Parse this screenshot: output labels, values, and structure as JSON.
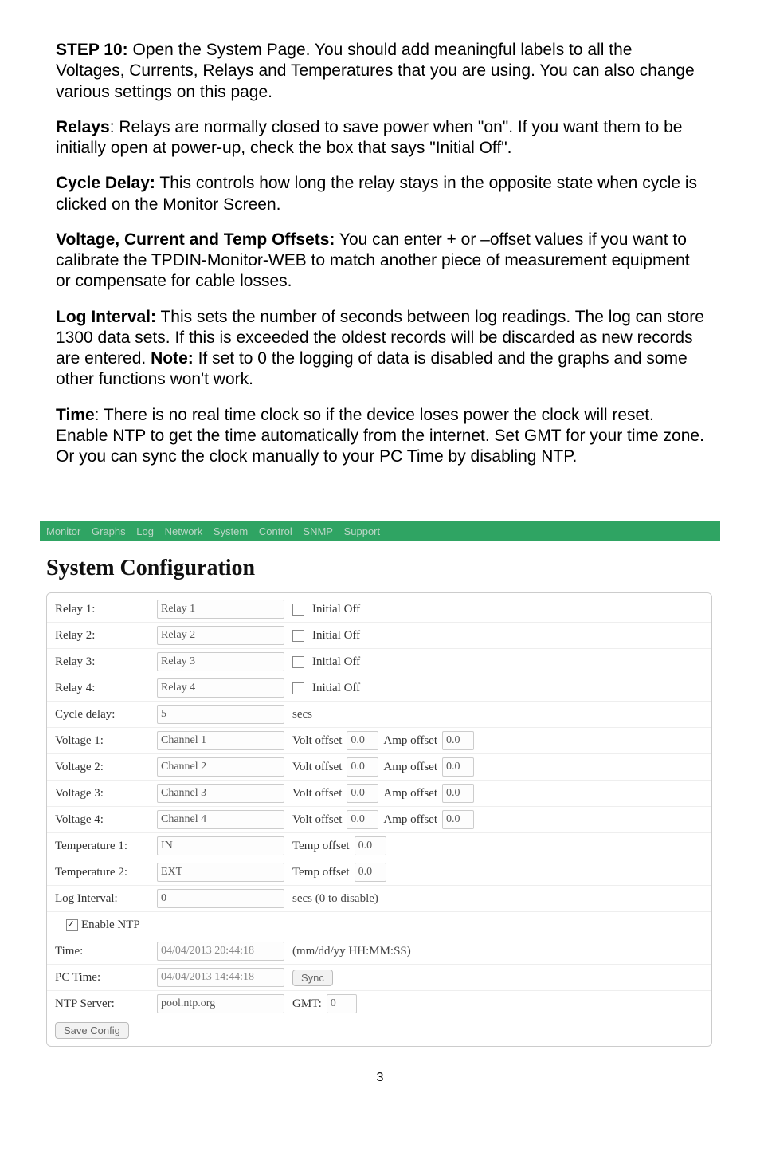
{
  "doc": {
    "step10": "STEP 10:",
    "step10_body": " Open the System Page. You should add meaningful labels to all the Voltages, Currents, Relays and Temperatures that you are using. You can also change various settings on this page.",
    "relays_label": "Relays",
    "relays_body": ": Relays are normally closed to save power when \"on\". If you want them to be initially open at power-up, check the box that says \"Initial Off\".",
    "cycle_label": "Cycle Delay:",
    "cycle_body": " This controls how long the relay stays in the opposite state when cycle is clicked on the Monitor Screen.",
    "offsets_label": "Voltage, Current and Temp Offsets:",
    "offsets_body": " You can enter + or –offset values if you want to calibrate the TPDIN-Monitor-WEB to match another piece of measurement equipment or compensate for cable losses.",
    "logint_label": "Log Interval:",
    "logint_body_1": " This sets the number of seconds between log readings. The log can store 1300 data sets. If this is exceeded the oldest records will be discarded as new records are entered. ",
    "logint_note": "Note:",
    "logint_body_2": " If set to 0 the logging of data is disabled and the graphs and some other functions won't work.",
    "time_label": "Time",
    "time_body": ": There is no real time clock so if the device loses power the clock will reset. Enable NTP to get the time automatically from the internet. Set GMT for your time zone. Or you can sync the clock manually to your PC Time by disabling NTP."
  },
  "nav": {
    "monitor": "Monitor",
    "graphs": "Graphs",
    "log": "Log",
    "network": "Network",
    "system": "System",
    "control": "Control",
    "snmp": "SNMP",
    "support": "Support"
  },
  "heading": "System Configuration",
  "labels": {
    "relay1": "Relay 1:",
    "relay2": "Relay 2:",
    "relay3": "Relay 3:",
    "relay4": "Relay 4:",
    "cycle_delay": "Cycle delay:",
    "voltage1": "Voltage 1:",
    "voltage2": "Voltage 2:",
    "voltage3": "Voltage 3:",
    "voltage4": "Voltage 4:",
    "temp1": "Temperature 1:",
    "temp2": "Temperature 2:",
    "log_interval": "Log Interval:",
    "enable_ntp": "Enable NTP",
    "time": "Time:",
    "pc_time": "PC Time:",
    "ntp_server": "NTP Server:",
    "initial_off": "Initial Off",
    "secs": "secs",
    "volt_offset": "Volt offset",
    "amp_offset": "Amp offset",
    "temp_offset": "Temp offset",
    "secs_disable": "secs (0 to disable)",
    "time_format": "(mm/dd/yy HH:MM:SS)",
    "sync": "Sync",
    "gmt": "GMT:",
    "save": "Save Config"
  },
  "values": {
    "relay1": "Relay 1",
    "relay2": "Relay 2",
    "relay3": "Relay 3",
    "relay4": "Relay 4",
    "cycle_delay": "5",
    "voltage1": "Channel 1",
    "voltage2": "Channel 2",
    "voltage3": "Channel 3",
    "voltage4": "Channel 4",
    "volt_off1": "0.0",
    "amp_off1": "0.0",
    "volt_off2": "0.0",
    "amp_off2": "0.0",
    "volt_off3": "0.0",
    "amp_off3": "0.0",
    "volt_off4": "0.0",
    "amp_off4": "0.0",
    "temp1": "IN",
    "temp2": "EXT",
    "temp_off1": "0.0",
    "temp_off2": "0.0",
    "log_interval": "0",
    "time": "04/04/2013 20:44:18",
    "pc_time": "04/04/2013 14:44:18",
    "ntp_server": "pool.ntp.org",
    "gmt": "0"
  },
  "page_number": "3"
}
